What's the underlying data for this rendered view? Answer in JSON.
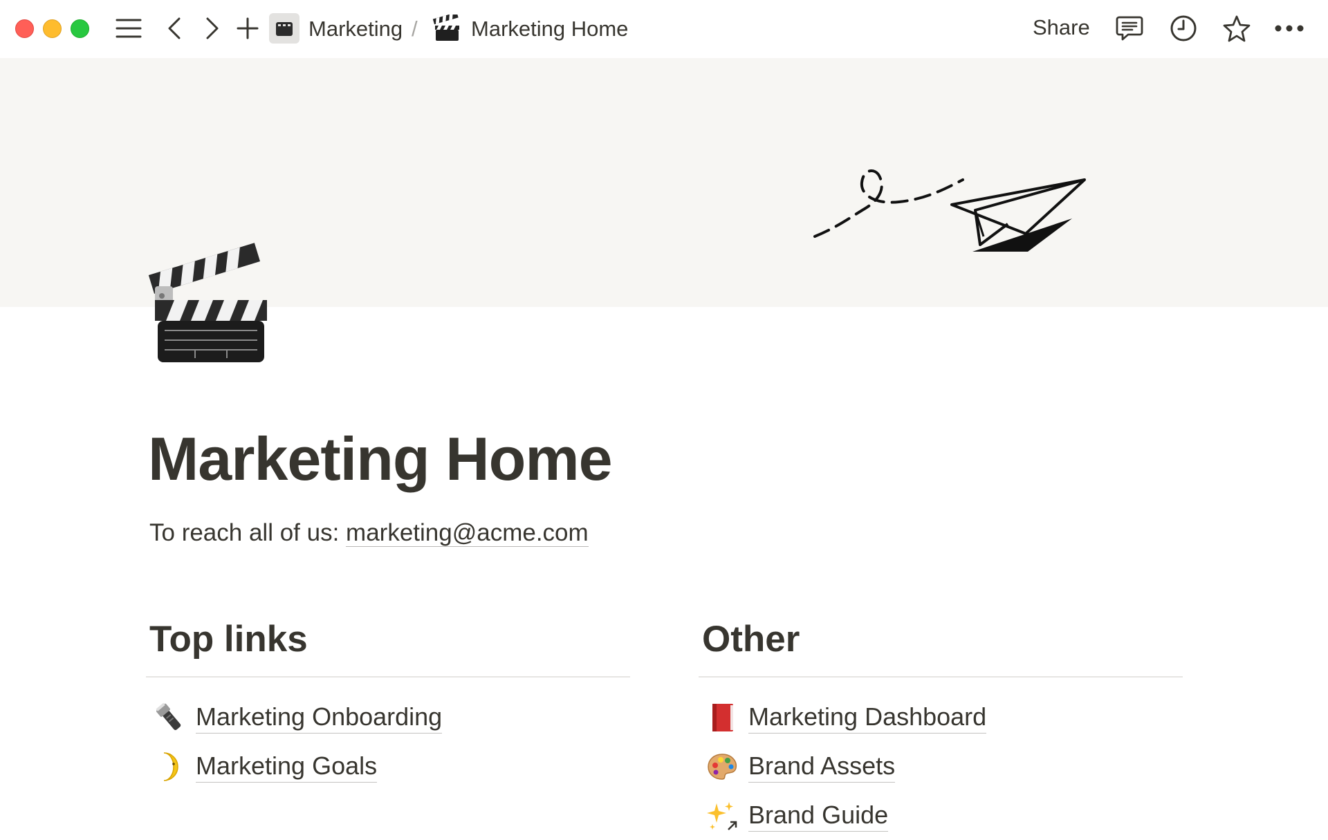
{
  "topbar": {
    "breadcrumb_parent": "Marketing",
    "breadcrumb_separator": "/",
    "breadcrumb_current": "Marketing Home",
    "share_label": "Share"
  },
  "icons": {
    "sidebar_toggle": "hamburger-icon",
    "back": "chevron-left-icon",
    "forward": "chevron-right-icon",
    "new_page": "plus-icon",
    "comments": "comment-icon",
    "updates": "clock-icon",
    "favorite": "star-icon",
    "more": "more-icon",
    "page_icon": "clapperboard-icon"
  },
  "page": {
    "title": "Marketing Home",
    "contact_prefix": "To reach all of us: ",
    "contact_email": "marketing@acme.com"
  },
  "columns": {
    "left": {
      "heading": "Top links",
      "items": [
        {
          "emoji": "flashlight",
          "label": "Marketing Onboarding"
        },
        {
          "emoji": "crescent-moon",
          "label": "Marketing Goals"
        }
      ]
    },
    "right": {
      "heading": "Other",
      "items": [
        {
          "emoji": "red-book",
          "label": "Marketing Dashboard"
        },
        {
          "emoji": "artist-palette",
          "label": "Brand Assets"
        },
        {
          "emoji": "sparkles",
          "label": "Brand Guide"
        }
      ]
    }
  },
  "colors": {
    "text": "#37352f",
    "cover_bg": "#f7f6f3",
    "traffic_red": "#ff5f57",
    "traffic_yellow": "#febc2e",
    "traffic_green": "#28c840"
  }
}
